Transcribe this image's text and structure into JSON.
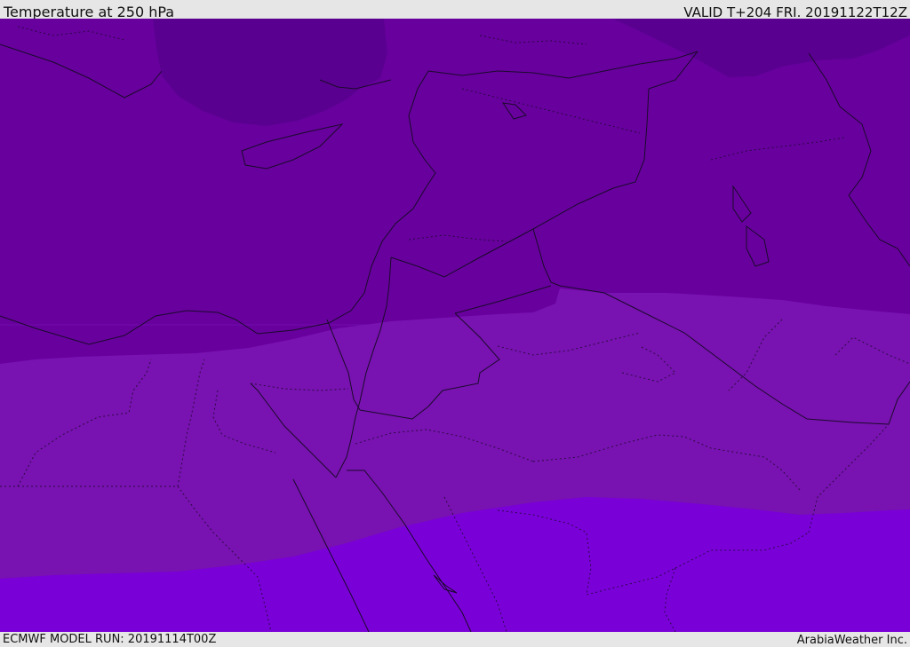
{
  "header": {
    "title": "Temperature at 250 hPa",
    "valid_time": "VALID T+204 FRI. 20191122T12Z"
  },
  "footer": {
    "model_run": "ECMWF MODEL RUN: 20191114T00Z",
    "credit": "ArabiaWeather Inc."
  },
  "map": {
    "field": "temperature",
    "level": "250 hPa",
    "shading_colors": {
      "coldest": "#5a0090",
      "cold": "#68009e",
      "mid": "#7812b0",
      "warm": "#7a00d8"
    },
    "line_colors": {
      "coast": "#1a0a2a",
      "border": "#1a0a2a"
    }
  }
}
